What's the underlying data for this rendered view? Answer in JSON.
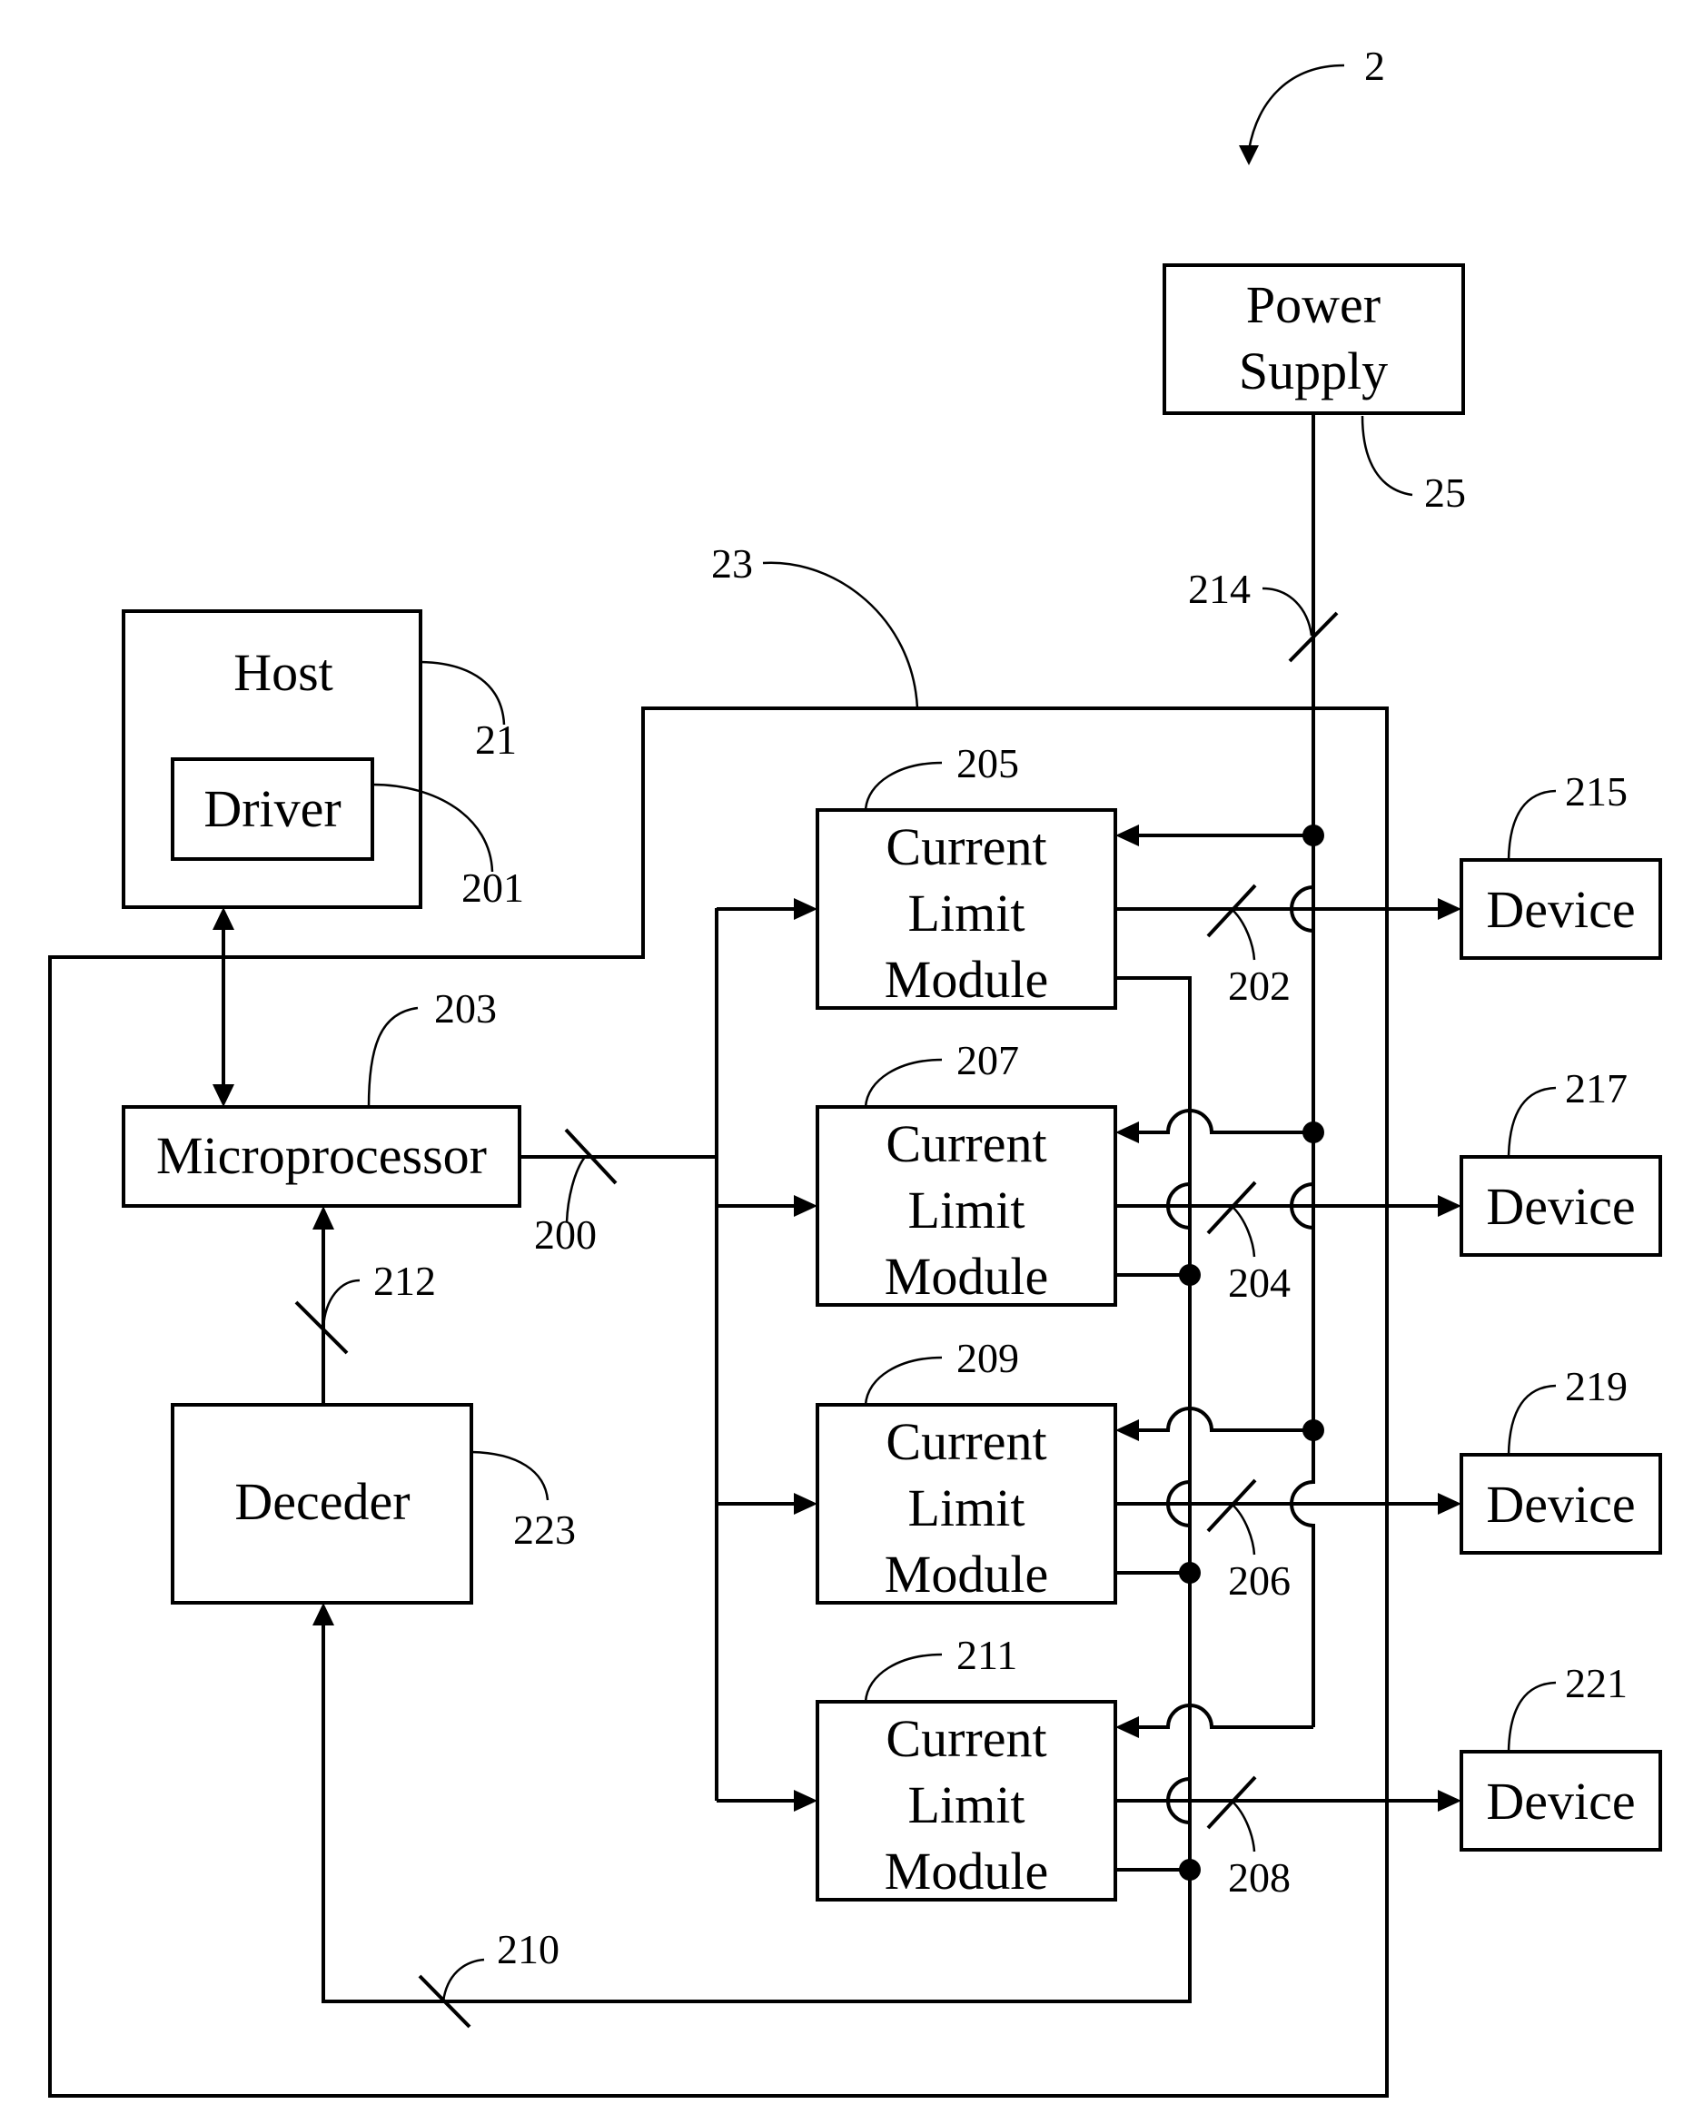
{
  "figure": {
    "ref": "2"
  },
  "blocks": {
    "power_supply": {
      "lines": [
        "Power",
        "Supply"
      ],
      "ref": "25"
    },
    "host": {
      "label": "Host",
      "ref": "21"
    },
    "driver": {
      "label": "Driver",
      "ref": "201"
    },
    "microprocessor": {
      "label": "Microprocessor",
      "ref": "203"
    },
    "decoder": {
      "label": "Deceder",
      "ref": "223"
    },
    "enclosure": {
      "ref": "23"
    }
  },
  "modules": [
    {
      "lines": [
        "Current",
        "Limit",
        "Module"
      ],
      "ref": "205",
      "out_bus_ref": "202",
      "device": {
        "label": "Device",
        "ref": "215"
      }
    },
    {
      "lines": [
        "Current",
        "Limit",
        "Module"
      ],
      "ref": "207",
      "out_bus_ref": "204",
      "device": {
        "label": "Device",
        "ref": "217"
      }
    },
    {
      "lines": [
        "Current",
        "Limit",
        "Module"
      ],
      "ref": "209",
      "out_bus_ref": "206",
      "device": {
        "label": "Device",
        "ref": "219"
      }
    },
    {
      "lines": [
        "Current",
        "Limit",
        "Module"
      ],
      "ref": "211",
      "out_bus_ref": "208",
      "device": {
        "label": "Device",
        "ref": "221"
      }
    }
  ],
  "buses": {
    "control": "200",
    "decoder_to_mcu": "212",
    "feedback": "210",
    "power": "214"
  }
}
